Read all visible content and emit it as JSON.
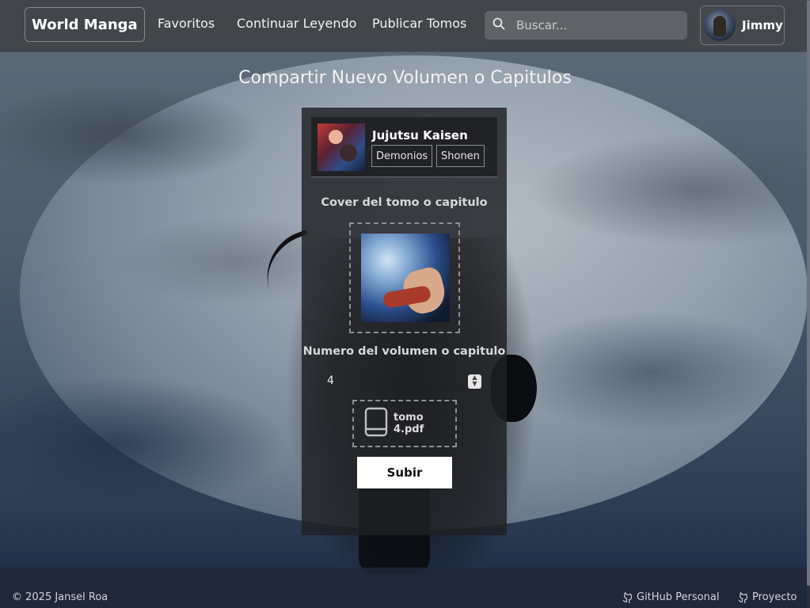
{
  "navbar": {
    "brand": "World Manga",
    "links": [
      "Favoritos",
      "Continuar Leyendo",
      "Publicar Tomos"
    ],
    "search_placeholder": "Buscar...",
    "user_name": "Jimmy"
  },
  "page": {
    "title": "Compartir Nuevo Volumen o Capitulos"
  },
  "manga": {
    "title": "Jujutsu Kaisen",
    "tags": [
      "Demonios",
      "Shonen"
    ]
  },
  "form": {
    "cover_label": "Cover del tomo o capitulo",
    "number_label": "Numero del volumen o capitulo",
    "number_value": "4",
    "file_name": "tomo 4.pdf",
    "submit_label": "Subir"
  },
  "footer": {
    "copyright": "© 2025 Jansel Roa",
    "links": [
      "GitHub Personal",
      "Proyecto"
    ]
  },
  "icons": {
    "search": "search-icon",
    "file": "book-icon",
    "github": "github-icon"
  }
}
